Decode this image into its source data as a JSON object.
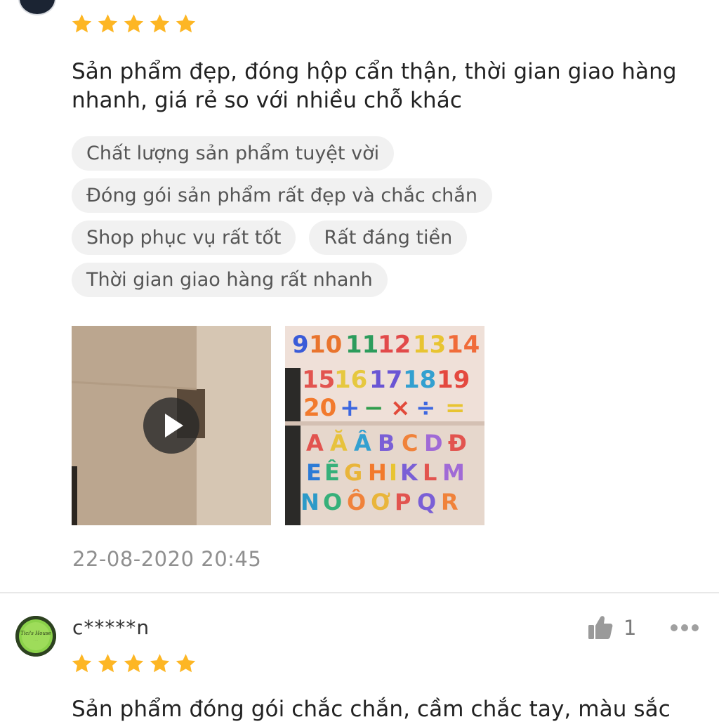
{
  "review1": {
    "rating": 5,
    "text": "Sản phẩm đẹp, đóng hộp cẩn thận, thời gian giao hàng nhanh, giá rẻ so với nhiều chỗ khác",
    "tags_row1": [
      "Chất lượng sản phẩm tuyệt vời"
    ],
    "tags_row2": [
      "Đóng gói sản phẩm rất đẹp và chắc chắn"
    ],
    "tags_row3": [
      "Shop phục vụ rất tốt",
      "Rất đáng tiền"
    ],
    "tags_row4": [
      "Thời gian giao hàng rất nhanh"
    ],
    "timestamp": "22-08-2020 20:45"
  },
  "review2": {
    "username": "c*****n",
    "avatar_text": "Tici's House",
    "rating": 5,
    "likes": "1",
    "text": "Sản phẩm đóng gói chắc chắn, cầm chắc tay, màu sắc"
  },
  "colors": {
    "star": "#fdb624",
    "tag_bg": "#f1f1f1",
    "muted_text": "#8f8f8f"
  },
  "icons": [
    "star-icon",
    "play-icon",
    "thumbs-up-icon",
    "more-icon"
  ]
}
